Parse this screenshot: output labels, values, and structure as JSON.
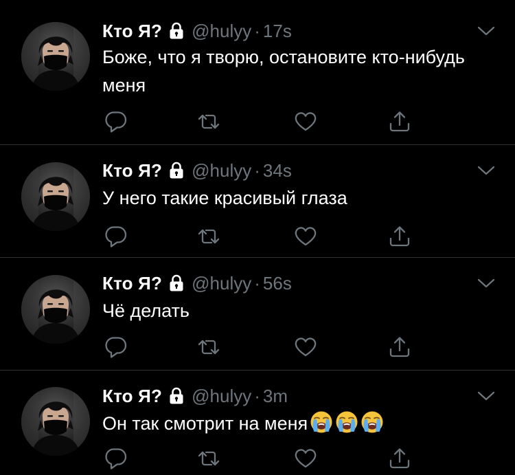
{
  "colors": {
    "background": "#000000",
    "text": "#ffffff",
    "muted": "#6e767d",
    "divider": "#2f3336"
  },
  "tweets": [
    {
      "name": "Кто Я?",
      "handle": "@hulyy",
      "separator": "·",
      "time": "17s",
      "text": "Боже, что я творю, остановите кто-нибудь меня",
      "emoji_count": 0
    },
    {
      "name": "Кто Я?",
      "handle": "@hulyy",
      "separator": "·",
      "time": "34s",
      "text": "У него такие красивый глаза",
      "emoji_count": 0
    },
    {
      "name": "Кто Я?",
      "handle": "@hulyy",
      "separator": "·",
      "time": "56s",
      "text": "Чё делать",
      "emoji_count": 0
    },
    {
      "name": "Кто Я?",
      "handle": "@hulyy",
      "separator": "·",
      "time": "3m",
      "text": "Он так смотрит на меня",
      "emoji": "loudly-crying-face",
      "emoji_count": 3
    }
  ],
  "icons": {
    "lock": "lock-icon",
    "caret": "chevron-down-icon",
    "reply": "reply-icon",
    "retweet": "retweet-icon",
    "like": "heart-icon",
    "share": "share-icon"
  }
}
